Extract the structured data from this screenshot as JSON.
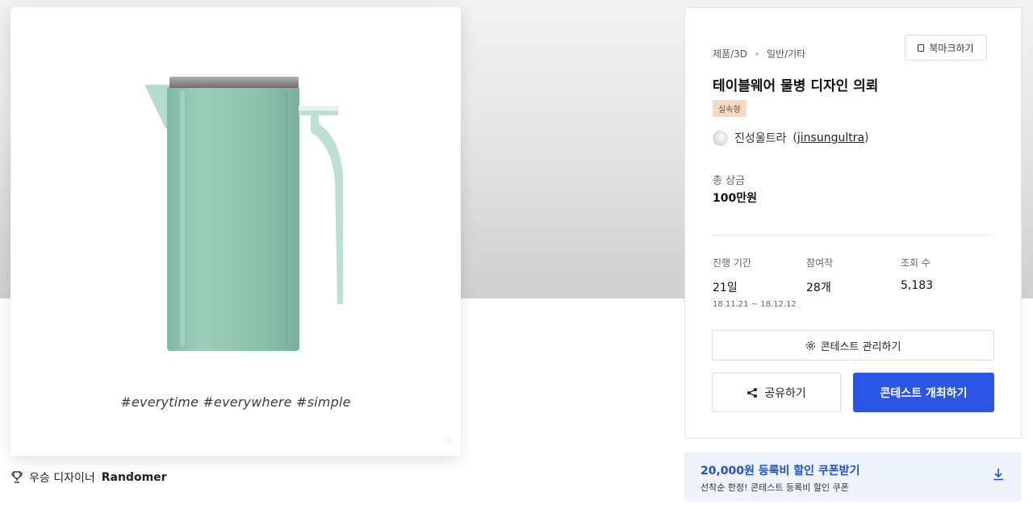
{
  "artwork": {
    "hashtags": "#everytime #everywhere #simple",
    "watermark": "ⓘ",
    "colors": {
      "pitcher_body": "#8fc4b1",
      "pitcher_lid": "#8e8e8e"
    }
  },
  "winner": {
    "label": "우승 디자이너",
    "name": "Randomer"
  },
  "contest": {
    "category": "제품/3D",
    "subcategory": "일반/기타",
    "bookmark_label": "북마크하기",
    "title": "테이블웨어 물병 디자인 의뢰",
    "badge": "실속형",
    "host_name": "진성울트라",
    "host_handle": "jinsungultra",
    "prize_label": "총 상금",
    "prize_value": "100만원",
    "stats": {
      "period_label": "진행 기간",
      "period_value": "21일",
      "period_range": "18.11.21 ~ 18.12.12",
      "entries_label": "참여작",
      "entries_value": "28개",
      "views_label": "조회 수",
      "views_value": "5,183"
    },
    "manage_label": "콘테스트 관리하기",
    "share_label": "공유하기",
    "host_button_label": "콘테스트 개최하기",
    "accent_color": "#2a55e5"
  },
  "coupon": {
    "title": "20,000원 등록비 할인 쿠폰받기",
    "subtitle": "선착순 한정! 콘테스트 등록비 할인 쿠폰"
  }
}
